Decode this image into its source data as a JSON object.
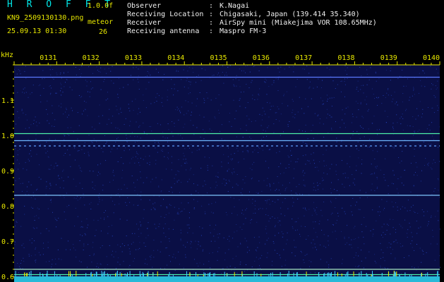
{
  "header": {
    "brand": "H R O F F T",
    "version": "1.0.0f",
    "filename": "KN9_2509130130.png",
    "datetime": "25.09.13 01:30",
    "meteor_label": "meteor",
    "meteor_count": "26",
    "info": [
      {
        "label": "Observer",
        "value": "K.Nagai"
      },
      {
        "label": "Receiving Location",
        "value": "Chigasaki, Japan (139.414 35.340)"
      },
      {
        "label": "Receiver",
        "value": "AirSpy mini (Miakejima VOR 108.65MHz)"
      },
      {
        "label": "Receiving antenna",
        "value": "Maspro FM-3"
      }
    ]
  },
  "chart_data": {
    "type": "heatmap",
    "ylabel": "kHz",
    "ylim": [
      0.6,
      1.2
    ],
    "yticks": [
      "1.1",
      "1.0",
      "0.9",
      "0.8",
      "0.7",
      "0.6"
    ],
    "xticks": [
      "0131",
      "0132",
      "0133",
      "0134",
      "0135",
      "0136",
      "0137",
      "0138",
      "0139",
      "0140"
    ],
    "xlim": [
      "0130",
      "0140"
    ],
    "lines": [
      {
        "freq_khz": 1.165,
        "color": "#5a78ff"
      },
      {
        "freq_khz": 1.005,
        "color": "#4cf0a8"
      },
      {
        "freq_khz": 0.985,
        "color": "#6fb6ff"
      },
      {
        "freq_khz": 0.97,
        "color": "#5a9cff",
        "dashed": true
      },
      {
        "freq_khz": 0.83,
        "color": "#7fc6ff"
      },
      {
        "freq_khz": 0.62,
        "color": "#a8e8c0"
      },
      {
        "freq_khz": 0.605,
        "color": "#4cf0a8"
      }
    ],
    "colors": {
      "background": "#0a0f45",
      "noise": "#2a4cd0",
      "axis": "#e8e800",
      "baseline": "#28b9d8"
    }
  }
}
